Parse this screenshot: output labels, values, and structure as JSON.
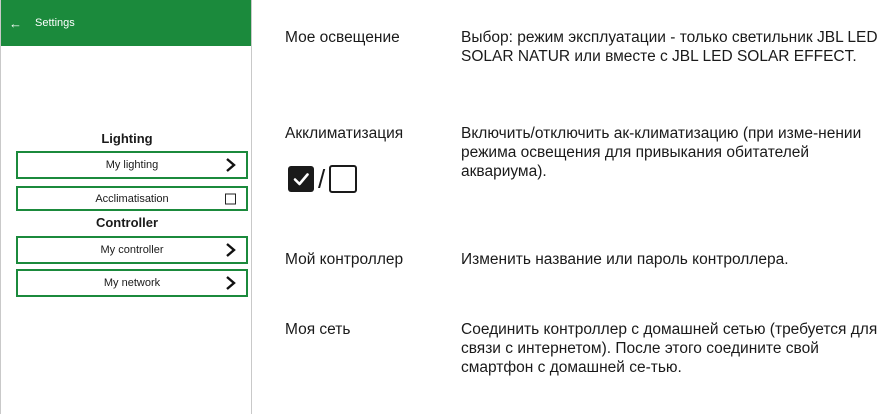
{
  "phone": {
    "appbar": {
      "back_icon": "arrow-left-icon",
      "title": "Settings"
    },
    "sections": {
      "lighting": {
        "title": "Lighting",
        "my_lighting": "My lighting",
        "acclimatisation": "Acclimatisation"
      },
      "controller": {
        "title": "Controller",
        "my_controller": "My controller",
        "my_network": "My network"
      }
    },
    "colors": {
      "accent": "#1b8a3c"
    }
  },
  "descriptions": [
    {
      "term": "Мое освещение",
      "text": "Выбор: режим эксплуатации - только светильник JBL LED SOLAR NATUR или вместе с JBL LED SOLAR EFFECT."
    },
    {
      "term": "Акклиматизация",
      "text": "Включить/отключить ак-климатизацию (при изме-нении режима освещения для привыкания обитателей аквариума).",
      "separator": "/"
    },
    {
      "term": "Мой контроллер",
      "text": "Изменить название или пароль контроллера."
    },
    {
      "term": "Моя сеть",
      "text": "Соединить контроллер с домашней сетью (требуется для связи с интернетом). После этого соедините свой смартфон с домашней се-тью."
    }
  ]
}
